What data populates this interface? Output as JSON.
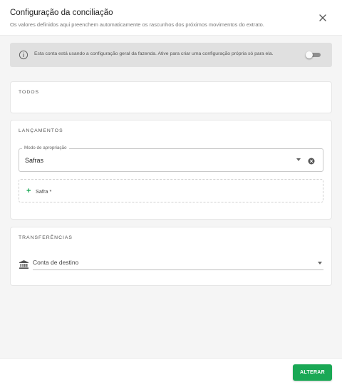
{
  "dialog": {
    "title": "Configuração da conciliação",
    "subtitle": "Os valores definidos aqui preenchem automaticamente os rascunhos dos próximos movimentos do extrato."
  },
  "banner": {
    "text": "Esta conta está usando a configuração geral da fazenda. Ative para criar uma configuração própria só para ela.",
    "toggle_on": false
  },
  "sections": {
    "todos": {
      "title": "TODOS"
    },
    "lancamentos": {
      "title": "LANÇAMENTOS",
      "select_label": "Modo de apropriação",
      "select_value": "Safras",
      "add_label": "Safra *"
    },
    "transferencias": {
      "title": "TRANSFERÊNCIAS",
      "destination_placeholder": "Conta de destino"
    }
  },
  "footer": {
    "submit_label": "ALTERAR"
  },
  "colors": {
    "accent": "#1aa855",
    "banner_bg": "#e0e0e0",
    "content_bg": "#f5f5f5"
  },
  "icons": [
    "close-icon",
    "info-icon",
    "chevron-down-icon",
    "clear-icon",
    "plus-icon",
    "bank-icon"
  ]
}
